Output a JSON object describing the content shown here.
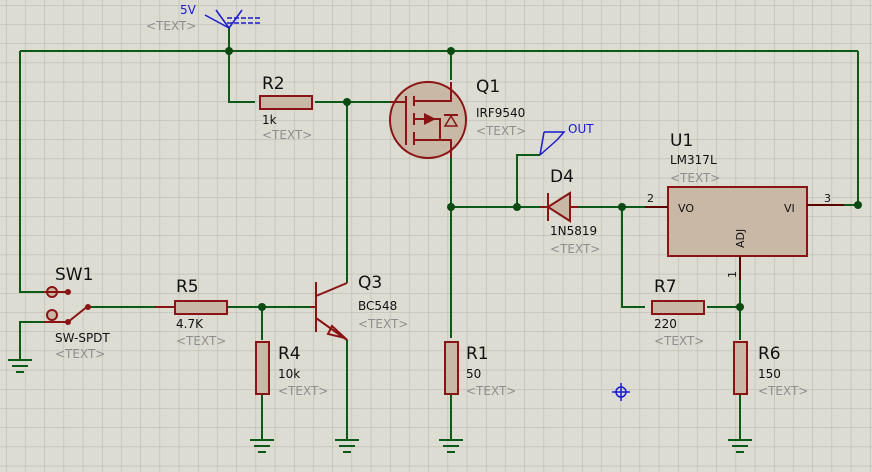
{
  "components": {
    "q1": {
      "ref": "Q1",
      "value": "IRF9540",
      "text": "<TEXT>"
    },
    "u1": {
      "ref": "U1",
      "value": "LM317L",
      "text": "<TEXT>",
      "pin_vo": "VO",
      "pin_vi": "VI",
      "pin_adj": "ADJ",
      "pin2": "2",
      "pin3": "3",
      "pin1": "1"
    },
    "r2": {
      "ref": "R2",
      "value": "1k",
      "text": "<TEXT>"
    },
    "d4": {
      "ref": "D4",
      "value": "1N5819",
      "text": "<TEXT>"
    },
    "sw1": {
      "ref": "SW1",
      "value": "SW-SPDT",
      "text": "<TEXT>"
    },
    "r5": {
      "ref": "R5",
      "value": "4.7K",
      "text": "<TEXT>"
    },
    "q3": {
      "ref": "Q3",
      "value": "BC548",
      "text": "<TEXT>"
    },
    "r7": {
      "ref": "R7",
      "value": "220",
      "text": "<TEXT>"
    },
    "r4": {
      "ref": "R4",
      "value": "10k",
      "text": "<TEXT>"
    },
    "r1": {
      "ref": "R1",
      "value": "50",
      "text": "<TEXT>"
    },
    "r6": {
      "ref": "R6",
      "value": "150",
      "text": "<TEXT>"
    }
  },
  "terminals": {
    "power": {
      "label": "5V",
      "text": "<TEXT>"
    },
    "out": {
      "label": "OUT"
    }
  },
  "colors": {
    "background": "#dcdcd2",
    "grid": "#b5b5ab",
    "wire": "#0b5a17",
    "component": "#8a1414",
    "component_fill": "#c9b8a5",
    "terminal": "#1a1ad0"
  }
}
